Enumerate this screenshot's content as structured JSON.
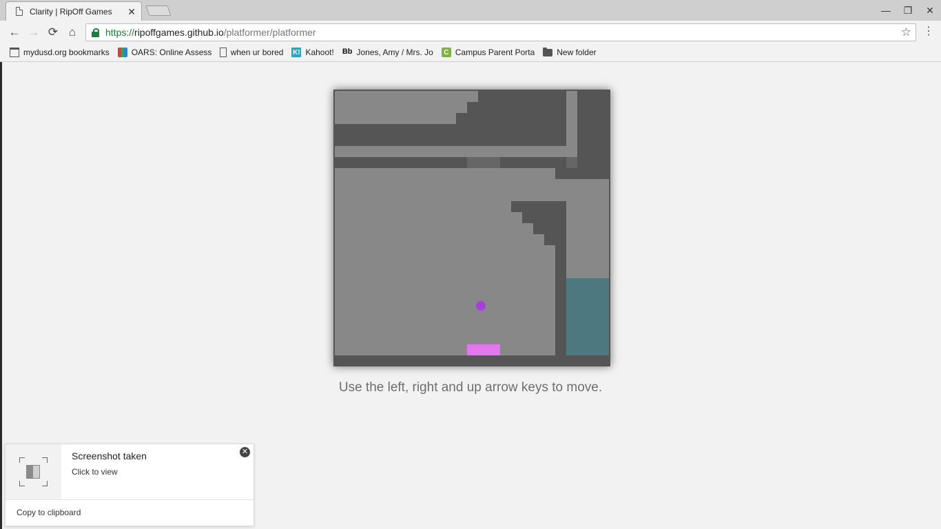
{
  "browser": {
    "tab_title": "Clarity | RipOff Games",
    "tab_icon": "page-icon",
    "url_scheme": "https://",
    "url_host": "ripoffgames.github.io",
    "url_path": "/platformer/platformer",
    "icons": {
      "back": "←",
      "forward": "→",
      "reload": "⟳",
      "home": "⌂",
      "star": "☆",
      "menu": "⋮",
      "close_tab": "✕",
      "minimize": "—",
      "restore": "❐",
      "close_window": "✕"
    },
    "bookmarks": [
      {
        "label": "mydusd.org bookmarks",
        "icon": "folder-grid-icon"
      },
      {
        "label": "OARS: Online Assessr",
        "icon": "oars-icon"
      },
      {
        "label": "when ur bored",
        "icon": "page-icon"
      },
      {
        "label": "Kahoot!",
        "icon": "kahoot-icon",
        "glyph": "K!"
      },
      {
        "label": "Jones, Amy / Mrs. Jo",
        "icon": "blackboard-icon",
        "glyph": "Bb"
      },
      {
        "label": "Campus Parent Porta",
        "icon": "campus-icon",
        "glyph": "C"
      },
      {
        "label": "New folder",
        "icon": "folder-icon"
      }
    ]
  },
  "game": {
    "instructions": "Use the left, right and up arrow keys to move.",
    "colors": {
      "background": "#888888",
      "wall": "#555555",
      "dim_block": "#666666",
      "water": "#4d7880",
      "player": "#a93ee0",
      "goal": "#e477ee"
    }
  },
  "notification": {
    "title": "Screenshot taken",
    "subtitle": "Click to view",
    "action": "Copy to clipboard",
    "close_glyph": "✕"
  }
}
